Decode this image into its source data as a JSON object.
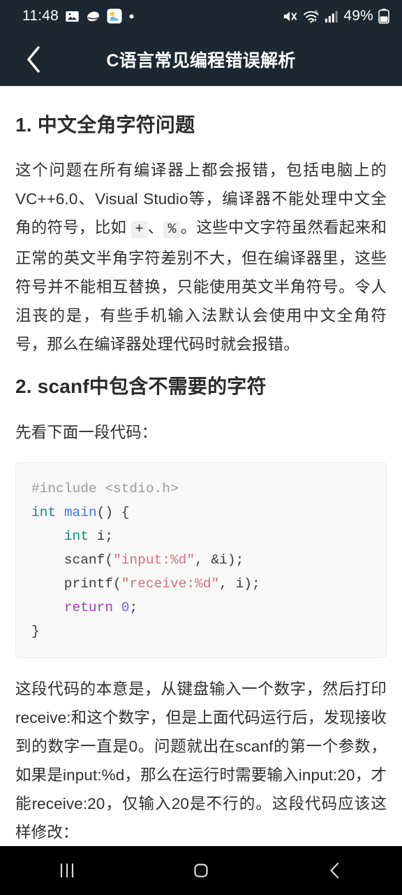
{
  "status_bar": {
    "time": "11:48",
    "battery_percent": "49%",
    "icons": [
      "image-icon",
      "cloud-icon",
      "weather-icon",
      "dot-icon",
      "mute-icon",
      "wifi-icon",
      "signal-icon",
      "battery-icon"
    ],
    "background_color": "#1c2731"
  },
  "app_bar": {
    "back_label": "‹",
    "title": "C语言常见编程错误解析",
    "background_color": "#1c2731",
    "title_color": "#ffffff"
  },
  "article": {
    "sections": [
      {
        "heading": "1. 中文全角字符问题",
        "paragraph_part1": "这个问题在所有编译器上都会报错，包括电脑上的VC++6.0、Visual Studio等，编译器不能处理中文全角的符号，比如 ",
        "inline_code_1": "+",
        "paragraph_part2": "、",
        "inline_code_2": "%",
        "paragraph_part3": "。这些中文字符虽然看起来和正常的英文半角字符差别不大，但在编译器里，这些符号并不能相互替换，只能使用英文半角符号。令人沮丧的是，有些手机输入法默认会使用中文全角符号，那么在编译器处理代码时就会报错。"
      },
      {
        "heading": "2. scanf中包含不需要的字符",
        "intro": "先看下面一段代码：",
        "code_lines": [
          [
            {
              "t": "#include ",
              "c": "pre"
            },
            {
              "t": "<stdio.h>",
              "c": "pre"
            }
          ],
          [
            {
              "t": "int",
              "c": "kw"
            },
            {
              "t": " ",
              "c": "pln"
            },
            {
              "t": "main",
              "c": "fn"
            },
            {
              "t": "() {",
              "c": "pln"
            }
          ],
          [
            {
              "t": "    ",
              "c": "pln"
            },
            {
              "t": "int",
              "c": "kw"
            },
            {
              "t": " i;",
              "c": "pln"
            }
          ],
          [
            {
              "t": "    scanf(",
              "c": "pln"
            },
            {
              "t": "\"input:%d\"",
              "c": "str"
            },
            {
              "t": ", &i);",
              "c": "pln"
            }
          ],
          [
            {
              "t": "    printf(",
              "c": "pln"
            },
            {
              "t": "\"receive:%d\"",
              "c": "str"
            },
            {
              "t": ", i);",
              "c": "pln"
            }
          ],
          [
            {
              "t": "    ",
              "c": "pln"
            },
            {
              "t": "return",
              "c": "ret"
            },
            {
              "t": " ",
              "c": "pln"
            },
            {
              "t": "0",
              "c": "num"
            },
            {
              "t": ";",
              "c": "pln"
            }
          ],
          [
            {
              "t": "}",
              "c": "pln"
            }
          ]
        ],
        "explanation": "这段代码的本意是，从键盘输入一个数字，然后打印receive:和这个数字，但是上面代码运行后，发现接收到的数字一直是0。问题就出在scanf的第一个参数，如果是input:%d，那么在运行时需要输入input:20，才能receive:20，仅输入20是不行的。这段代码应该这样修改："
      }
    ]
  },
  "nav_bar": {
    "recents_label": "recents-icon",
    "home_label": "home-icon",
    "back_label": "back-icon",
    "background_color": "#000000"
  },
  "theme": {
    "code_background": "#f8f8f9",
    "code_border": "#ececee",
    "inline_code_background": "#f0f0f1",
    "text_color": "#2f2f2f",
    "keyword_color": "#0e8f7d",
    "function_color": "#4078f2",
    "string_color": "#d4707c",
    "return_color": "#a040b0",
    "number_color": "#7d63d8"
  }
}
